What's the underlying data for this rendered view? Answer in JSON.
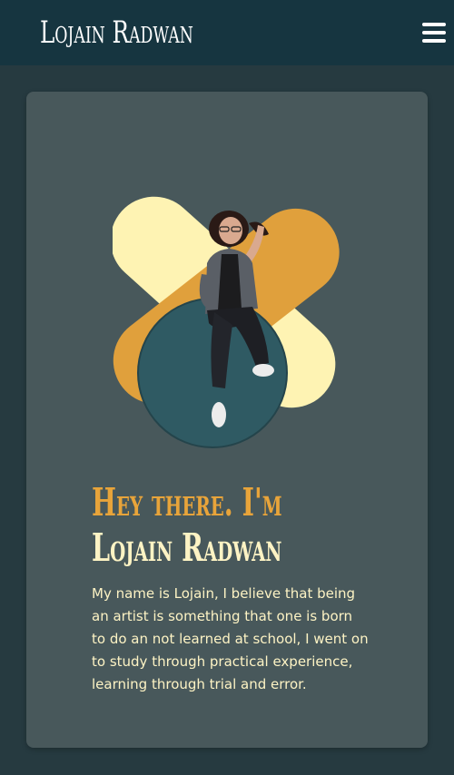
{
  "navbar": {
    "brand": "Lojain Radwan",
    "menu_icon": "hamburger-menu-icon"
  },
  "hero": {
    "greeting_line1": "Hey there. I'm",
    "greeting_line2": "Lojain Radwan",
    "bio": "My name is Lojain, I believe that being an artist is something that one is born to do an not learned at school, I went on to study through practical experience, learning through trial and error.",
    "portrait_alt": "portrait"
  },
  "colors": {
    "page_bg": "#263a40",
    "navbar_bg": "#163540",
    "card_bg": "#48585b",
    "accent_orange": "#e0a03c",
    "accent_cream": "#fef3b3",
    "circle_teal": "#2f5a63",
    "text_cream": "#fdf3c4"
  }
}
